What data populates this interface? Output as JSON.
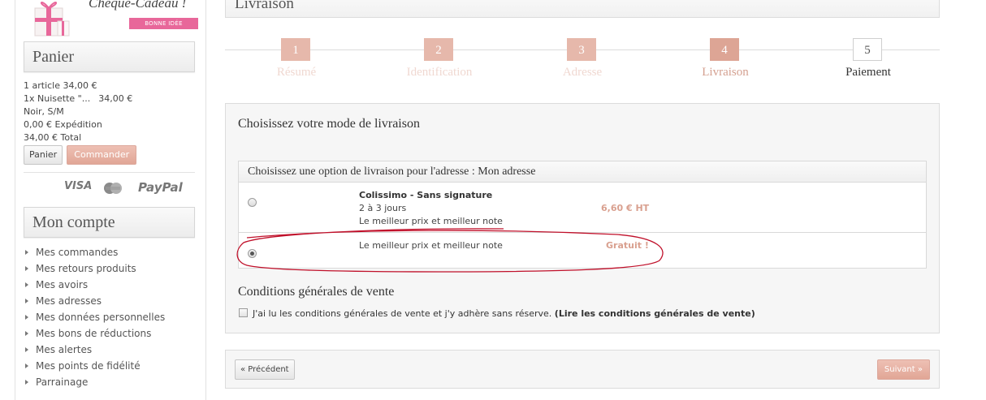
{
  "colors": {
    "accent": "#dda595",
    "accent_light": "#e6b8ab",
    "price": "#d9a08f",
    "scribble": "#c0102a"
  },
  "sidebar": {
    "gift": {
      "title": "Chèque-Cadeau !",
      "tag": "BONNE IDÉE"
    },
    "cart": {
      "heading": "Panier",
      "summary": "1 article 34,00 €",
      "item_name": "1x Nuisette \"...",
      "item_price": "34,00 €",
      "item_variant": "Noir, S/M",
      "shipping": "0,00 € Expédition",
      "total": "34,00 € Total",
      "cart_button": "Panier",
      "order_button": "Commander"
    },
    "payment_logos": {
      "visa": "VISA",
      "paypal": "PayPal",
      "mastercard_icon": "mastercard-icon"
    },
    "account": {
      "heading": "Mon compte",
      "items": [
        "Mes commandes",
        "Mes retours produits",
        "Mes avoirs",
        "Mes adresses",
        "Mes données personnelles",
        "Mes bons de réductions",
        "Mes alertes",
        "Mes points de fidélité",
        "Parrainage"
      ]
    }
  },
  "main": {
    "title": "Livraison",
    "steps": [
      {
        "num": "1",
        "label": "Résumé",
        "state": "done"
      },
      {
        "num": "2",
        "label": "Identification",
        "state": "done"
      },
      {
        "num": "3",
        "label": "Adresse",
        "state": "done"
      },
      {
        "num": "4",
        "label": "Livraison",
        "state": "active"
      },
      {
        "num": "5",
        "label": "Paiement",
        "state": "todo"
      }
    ],
    "delivery": {
      "title": "Choisissez votre mode de livraison",
      "table_header": "Choisissez une option de livraison pour l'adresse : Mon adresse",
      "options": [
        {
          "name": "Colissimo - Sans signature",
          "delay": "2 à 3 jours",
          "note": "Le meilleur prix et meilleur note",
          "price": "6,60 € HT",
          "selected": false
        },
        {
          "note": "Le meilleur prix et meilleur note",
          "price": "Gratuit !",
          "selected": true
        }
      ]
    },
    "cgv": {
      "title": "Conditions générales de vente",
      "text": "J'ai lu les conditions générales de vente et j'y adhère sans réserve.",
      "link": "(Lire les conditions générales de vente)",
      "checked": false
    },
    "nav": {
      "prev": "« Précédent",
      "next": "Suivant »"
    }
  }
}
